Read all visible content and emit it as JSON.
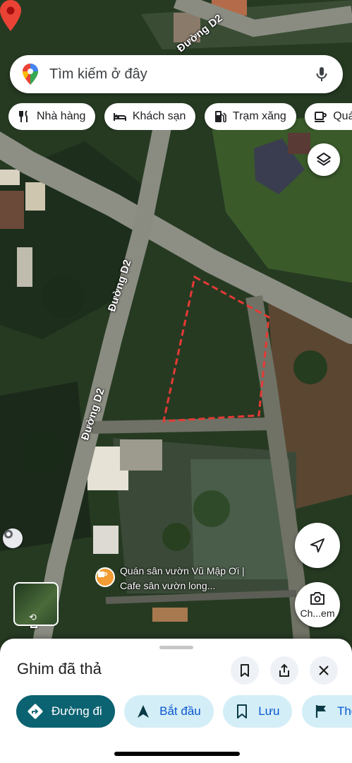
{
  "search": {
    "placeholder": "Tìm kiếm ở đây"
  },
  "chips": [
    {
      "icon": "restaurant-icon",
      "label": "Nhà hàng"
    },
    {
      "icon": "hotel-icon",
      "label": "Khách sạn"
    },
    {
      "icon": "gas-station-icon",
      "label": "Trạm xăng"
    },
    {
      "icon": "cafe-icon",
      "label": "Quán"
    }
  ],
  "map": {
    "road_labels": [
      "Đường D2",
      "Đường D2",
      "Đường D2",
      "D2"
    ],
    "place": {
      "name": "Quán sân vườn Vũ Mập Ơi | Cafe sân vườn long...",
      "icon": "cafe-icon"
    },
    "capture_label": "Ch...em",
    "pin_color": "#ea4335",
    "parcel_outline_color": "#e53935"
  },
  "sheet": {
    "title": "Ghim đã thả",
    "actions": [
      {
        "icon": "directions-icon",
        "label": "Đường đi"
      },
      {
        "icon": "navigation-arrow-icon",
        "label": "Bắt đầu"
      },
      {
        "icon": "bookmark-icon",
        "label": "Lưu"
      },
      {
        "icon": "flag-icon",
        "label": "Thêm"
      }
    ]
  },
  "colors": {
    "primary_action": "#0b6271",
    "secondary_action": "#d3eef6",
    "link_blue": "#0b57d0"
  }
}
